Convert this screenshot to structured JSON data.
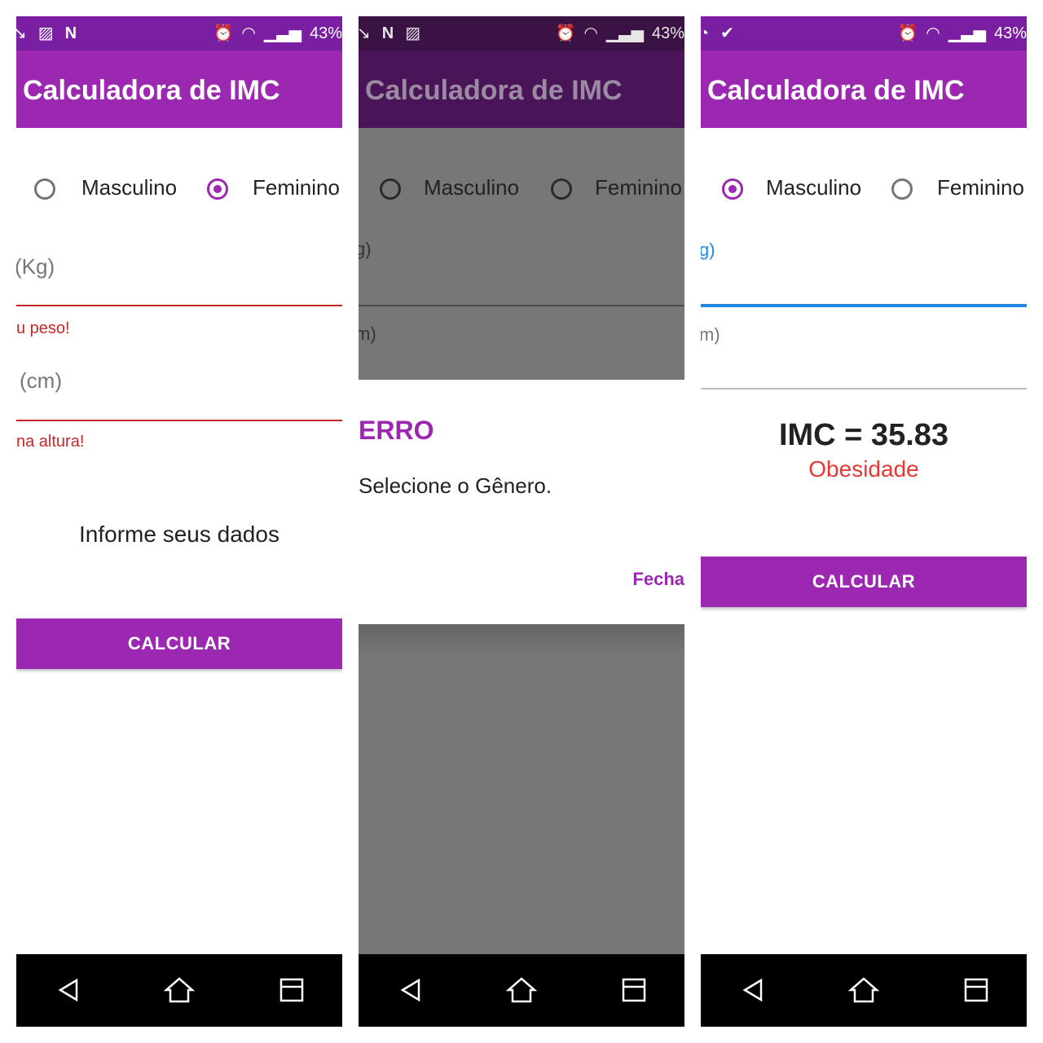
{
  "status": {
    "battery": "43%"
  },
  "app": {
    "title": "Calculadora de IMC"
  },
  "gender": {
    "male": "Masculino",
    "female": "Feminino"
  },
  "screen1": {
    "weight_hint": "(Kg)",
    "weight_error": "u peso!",
    "height_hint": "(cm)",
    "height_error": "na altura!",
    "info": "Informe seus dados",
    "button": "CALCULAR"
  },
  "screen2": {
    "weight_hint": "g)",
    "height_hint": "m)",
    "dialog_title": "ERRO",
    "dialog_message": "Selecione o Gênero.",
    "dialog_button": "Fecha"
  },
  "screen3": {
    "weight_hint": "g)",
    "height_hint": "m)",
    "result": "IMC = 35.83",
    "classification": "Obesidade",
    "button": "CALCULAR"
  },
  "colors": {
    "primary": "#9c27b0",
    "primary_dark": "#7b1fa2",
    "error": "#c62828",
    "result_class": "#e53935",
    "focus": "#1e88e5"
  },
  "icons": [
    "missed-call-icon",
    "image-icon",
    "n-icon",
    "alarm-icon",
    "wifi-icon",
    "signal-icon",
    "back-icon",
    "home-icon",
    "recents-icon"
  ]
}
